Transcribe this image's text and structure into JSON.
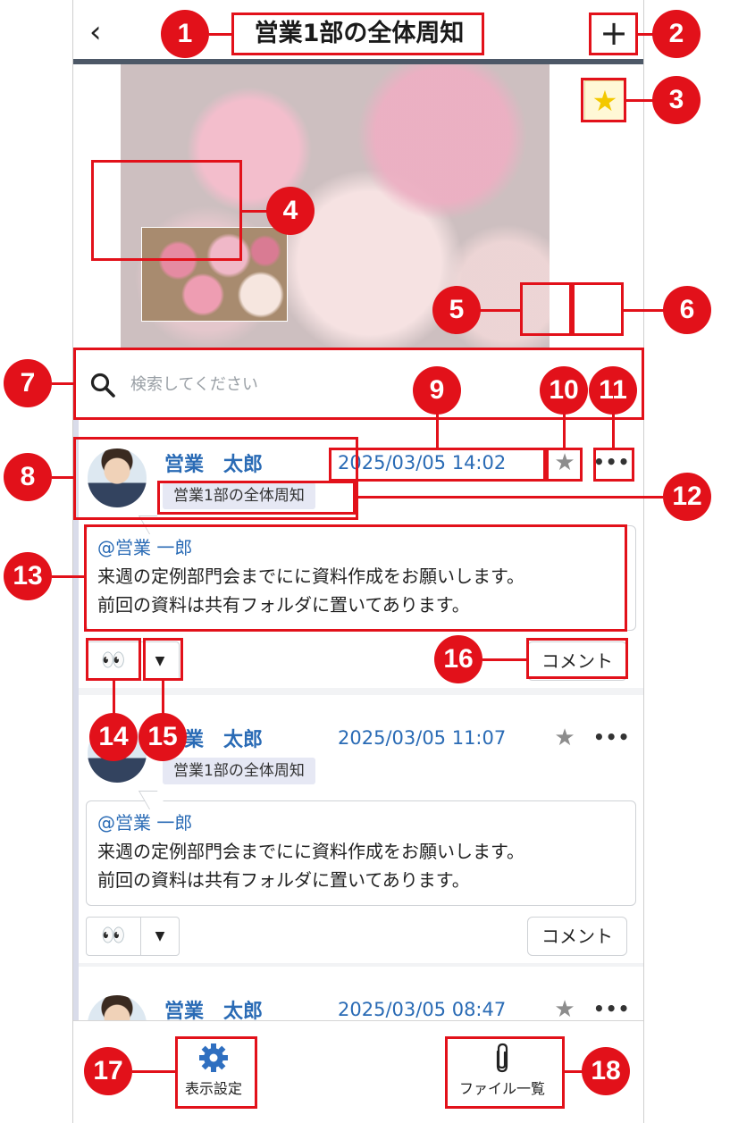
{
  "header": {
    "back_icon": "chevron-left-icon",
    "back_glyph": "‹",
    "title": "営業1部の全体周知",
    "add_glyph": "+"
  },
  "cover": {
    "favorite_glyph": "★"
  },
  "search": {
    "placeholder": "検索してください"
  },
  "posts": [
    {
      "author": "営業　太郎",
      "timestamp": "2025/03/05 14:02",
      "channel_tag": "営業1部の全体周知",
      "mention": "@営業 一郎",
      "lines": [
        "来週の定例部門会までにに資料作成をお願いします。",
        "前回の資料は共有フォルダに置いてあります。"
      ],
      "reaction": "👀",
      "comment_label": "コメント"
    },
    {
      "author": "営業　太郎",
      "timestamp": "2025/03/05 11:07",
      "channel_tag": "営業1部の全体周知",
      "mention": "@営業 一郎",
      "lines": [
        "来週の定例部門会までにに資料作成をお願いします。",
        "前回の資料は共有フォルダに置いてあります。"
      ],
      "reaction": "👀",
      "comment_label": "コメント"
    },
    {
      "author": "営業　太郎",
      "timestamp": "2025/03/05 08:47"
    }
  ],
  "post_controls": {
    "star_glyph": "★",
    "more_glyph": "•••",
    "dropdown_glyph": "▼"
  },
  "footer": {
    "display_settings_label": "表示設定",
    "file_list_label": "ファイル一覧"
  },
  "annotations": [
    "1",
    "2",
    "3",
    "4",
    "5",
    "6",
    "7",
    "8",
    "9",
    "10",
    "11",
    "12",
    "13",
    "14",
    "15",
    "16",
    "17",
    "18"
  ],
  "colors": {
    "annotation": "#e2111a",
    "link": "#2a6bb5",
    "header_rule": "#4d5867",
    "favorite": "#f3c800"
  }
}
